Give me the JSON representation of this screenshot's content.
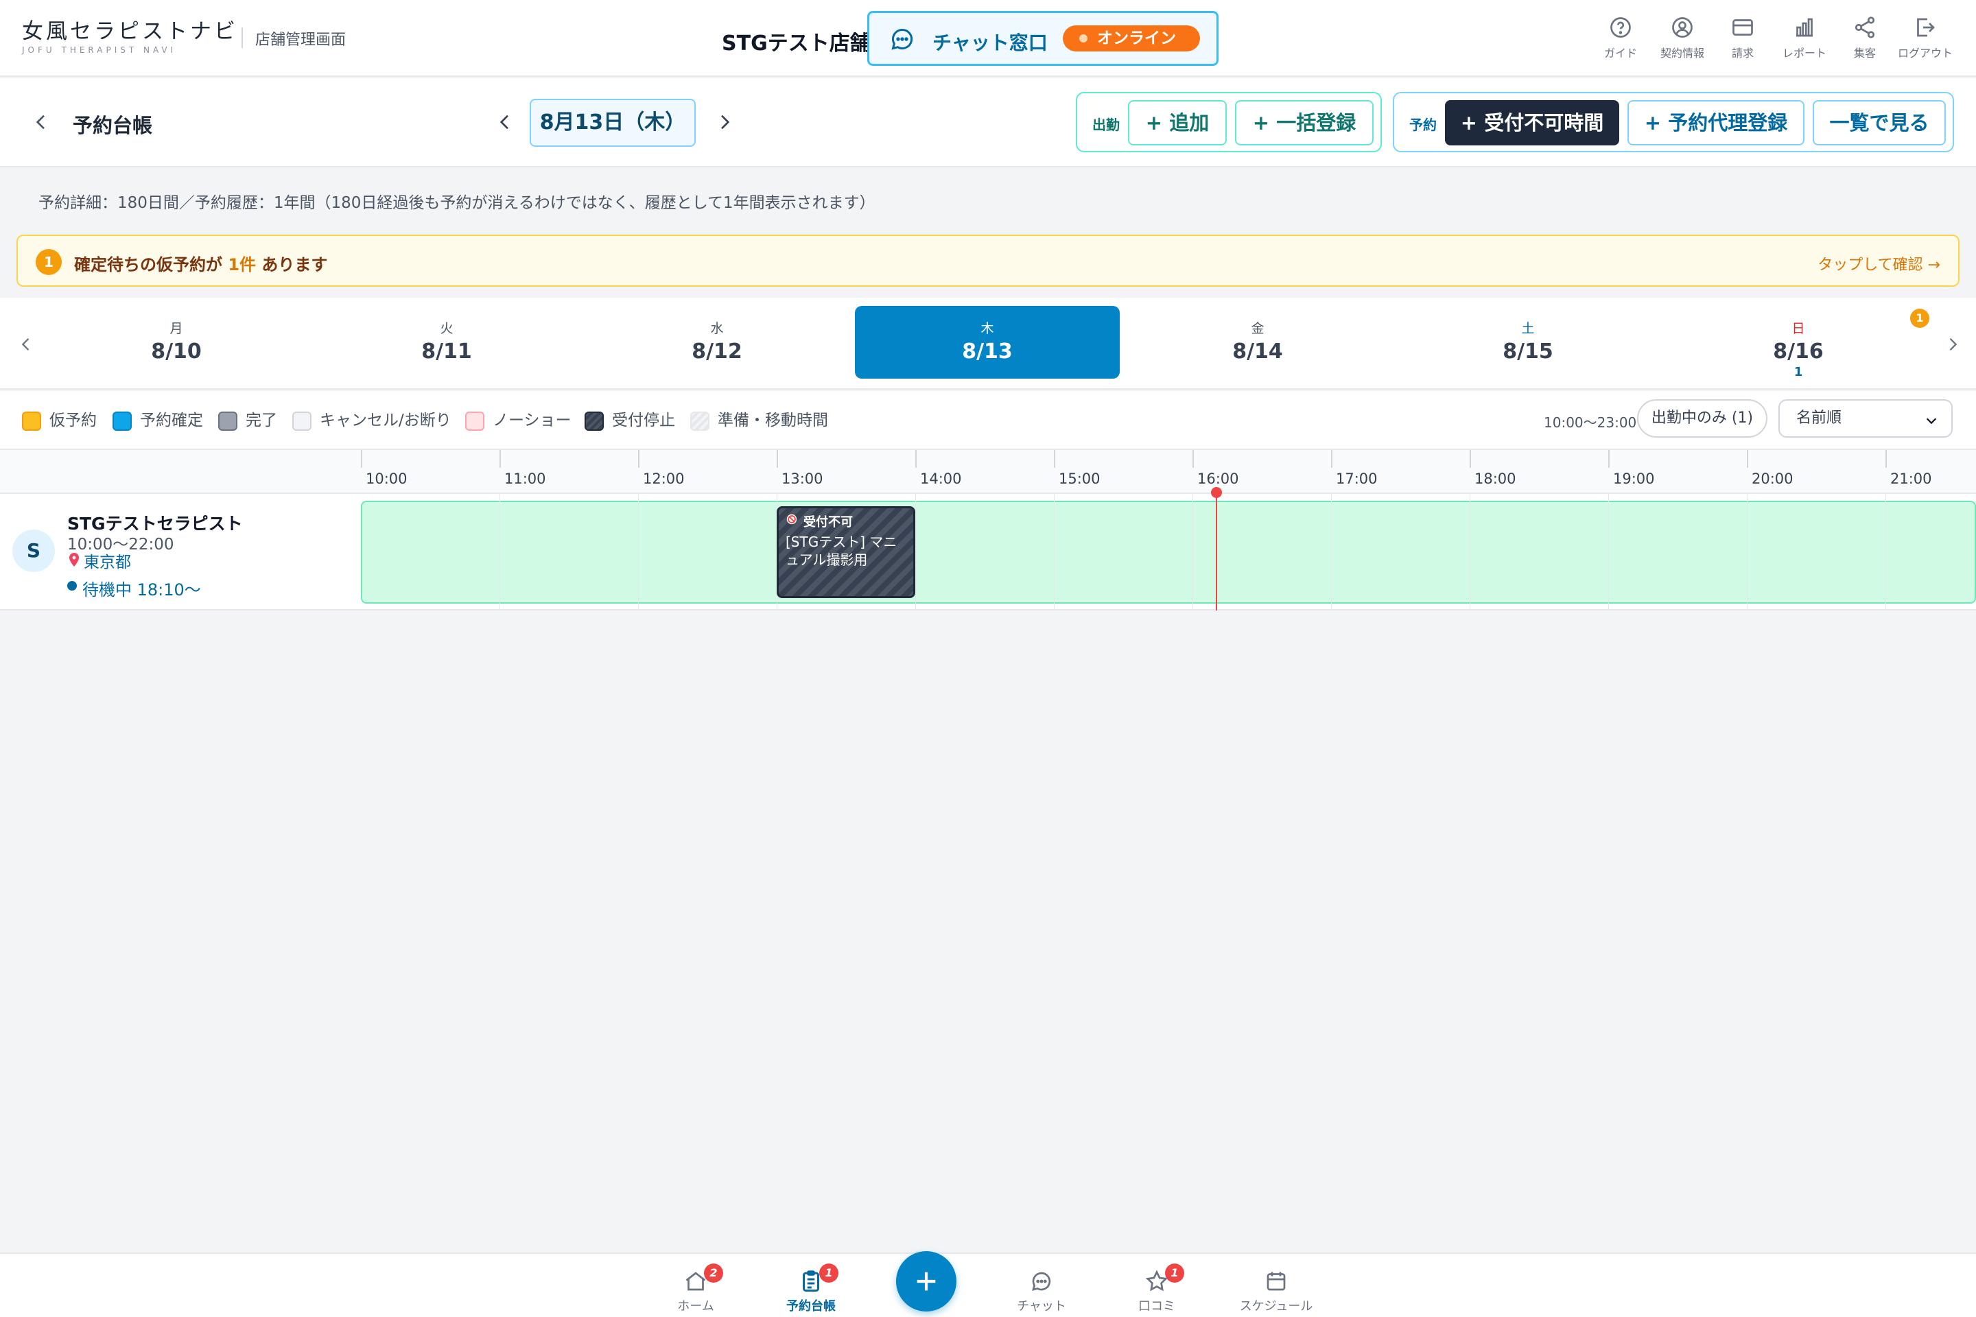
{
  "header": {
    "logo_main": "女風セラピストナビ",
    "logo_sub": "JOFU THERAPIST NAVI",
    "logo_mgmt": "店舗管理画面",
    "store_name": "STGテスト店舗",
    "chat_label": "チャット窓口",
    "chat_status": "オンライン",
    "nav": [
      {
        "label": "ガイド",
        "icon": "help-circle-icon"
      },
      {
        "label": "契約情報",
        "icon": "user-circle-icon"
      },
      {
        "label": "請求",
        "icon": "credit-card-icon"
      },
      {
        "label": "レポート",
        "icon": "bar-chart-icon"
      },
      {
        "label": "集客",
        "icon": "share-icon"
      },
      {
        "label": "ログアウト",
        "icon": "logout-icon"
      }
    ]
  },
  "toolbar": {
    "title": "予約台帳",
    "date": "8月13日（木）",
    "shift_group": {
      "label": "出勤",
      "add": "+ 追加",
      "bulk": "+ 一括登録"
    },
    "reserve_group": {
      "label": "予約",
      "block": "+ 受付不可時間",
      "proxy": "+ 予約代理登録",
      "list": "一覧で見る"
    }
  },
  "info_text": "予約詳細：180日間／予約履歴：1年間（180日経過後も予約が消えるわけではなく、履歴として1年間表示されます）",
  "alert": {
    "count": "1",
    "pre": "確定待ちの仮予約が ",
    "hl": "1件",
    "post": " あります",
    "link": "タップして確認 →"
  },
  "week": {
    "days": [
      {
        "dow": "月",
        "date": "8/10",
        "count": ""
      },
      {
        "dow": "火",
        "date": "8/11",
        "count": ""
      },
      {
        "dow": "水",
        "date": "8/12",
        "count": ""
      },
      {
        "dow": "木",
        "date": "8/13",
        "count": ""
      },
      {
        "dow": "金",
        "date": "8/14",
        "count": ""
      },
      {
        "dow": "土",
        "date": "8/15",
        "count": ""
      },
      {
        "dow": "日",
        "date": "8/16",
        "count": "1"
      }
    ],
    "selected": "8/13",
    "badge": "1"
  },
  "legend": {
    "items": [
      {
        "label": "仮予約",
        "color": "#fbbf24"
      },
      {
        "label": "予約確定",
        "color": "#0ea5e9"
      },
      {
        "label": "完了",
        "color": "#9ca3af"
      },
      {
        "label": "キャンセル/お断り",
        "color": "#e5e7eb"
      },
      {
        "label": "ノーショー",
        "color": "#fecdd3"
      },
      {
        "label": "受付停止",
        "color": "#4b5563"
      },
      {
        "label": "準備・移動時間",
        "color": "#e5e7eb"
      }
    ],
    "range": "10:00〜23:00",
    "filter": "出勤中のみ (1)",
    "sort": "名前順"
  },
  "timeline": {
    "hours": [
      "10:00",
      "11:00",
      "12:00",
      "13:00",
      "14:00",
      "15:00",
      "16:00",
      "17:00",
      "18:00",
      "19:00",
      "20:00",
      "21:00"
    ],
    "therapist": {
      "initial": "S",
      "name": "STGテストセラピスト",
      "hours": "10:00〜22:00",
      "location": "東京都",
      "status": "待機中 18:10〜"
    },
    "block": {
      "title": "受付不可",
      "desc": "[STGテスト] マニュアル撮影用"
    }
  },
  "bottom_nav": [
    {
      "label": "ホーム",
      "icon": "home-icon",
      "badge": "2"
    },
    {
      "label": "予約台帳",
      "icon": "clipboard-icon",
      "badge": "1"
    },
    {
      "label": "チャット",
      "icon": "chat-icon",
      "badge": ""
    },
    {
      "label": "口コミ",
      "icon": "star-icon",
      "badge": "1"
    },
    {
      "label": "スケジュール",
      "icon": "calendar-icon",
      "badge": ""
    }
  ]
}
